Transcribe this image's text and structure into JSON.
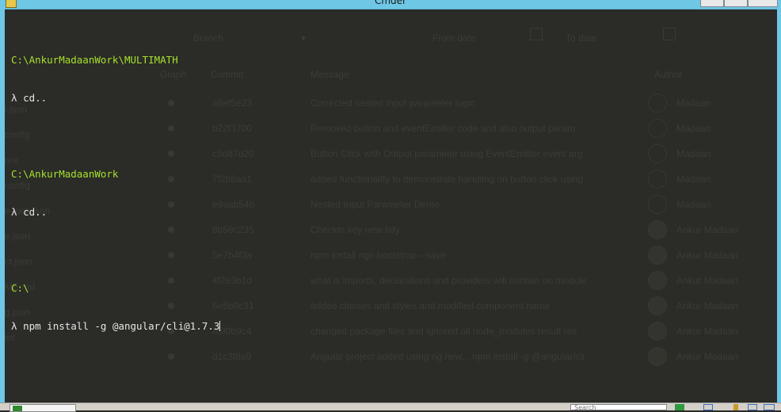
{
  "window": {
    "title": "Cmder"
  },
  "console": {
    "lines": [
      {
        "path": "C:\\AnkurMadaanWork\\MULTIMATH",
        "prompt": "λ",
        "command": "cd.."
      },
      {
        "path": "C:\\AnkurMadaanWork",
        "prompt": "λ",
        "command": "cd.."
      },
      {
        "path": "C:\\",
        "prompt": "λ",
        "command": "npm install -g @angular/cli@1.7.3"
      }
    ]
  },
  "background_app": {
    "filters": {
      "branch": "Branch:",
      "from_date": "From date",
      "to_date": "To date"
    },
    "headers": {
      "graph": "Graph",
      "commit": "Commit",
      "message": "Message",
      "author": "Author"
    },
    "left_items": [
      "i.json",
      "config",
      "ore",
      "config",
      "e-lock.json",
      "e.json",
      "ct.json",
      "ME.md",
      "g.json",
      "int"
    ],
    "commits": [
      {
        "hash": "a8ef5e23",
        "message": "Corrected nested input parameter logic",
        "author": "Madaan"
      },
      {
        "hash": "b22f3700",
        "message": "Removed button and eventEmitter code and also output param",
        "author": "Madaan"
      },
      {
        "hash": "c5d87d20",
        "message": "Button Click with Output parameter using EventEmitter event arg",
        "author": "Madaan"
      },
      {
        "hash": "7f2b8aa1",
        "message": "added functionality to demonstrate handling on button click using",
        "author": "Madaan"
      },
      {
        "hash": "e9aab54b",
        "message": "Nested Input Parameter Demo",
        "author": "Madaan"
      },
      {
        "hash": "8b59c235",
        "message": "Checkin key new tidy",
        "author": "Ankur Madaan"
      },
      {
        "hash": "5e7b4f3a",
        "message": "npm install ngx-bootstrap --save",
        "author": "Ankur Madaan"
      },
      {
        "hash": "4f2e3b1d",
        "message": "what is imports, declarations and providers will contain on module",
        "author": "Ankur Madaan"
      },
      {
        "hash": "6e5b9c31",
        "message": "added classes and styles and modified component name",
        "author": "Ankur Madaan"
      },
      {
        "hash": "a5f0b9c4",
        "message": "changed package files and ignored all node_modules result res",
        "author": "Ankur Madaan"
      },
      {
        "hash": "d1c3f8a9",
        "message": "Angular project added using ng new... npm install -g @angular/cli",
        "author": "Ankur Madaan"
      }
    ]
  },
  "statusbar": {
    "tab_label": "cmd",
    "search_placeholder": "Search"
  },
  "colors": {
    "console_bg": "#2b2b27",
    "path": "#a6e22e",
    "text": "#e6e6e6",
    "frame": "#6fc7e6"
  }
}
